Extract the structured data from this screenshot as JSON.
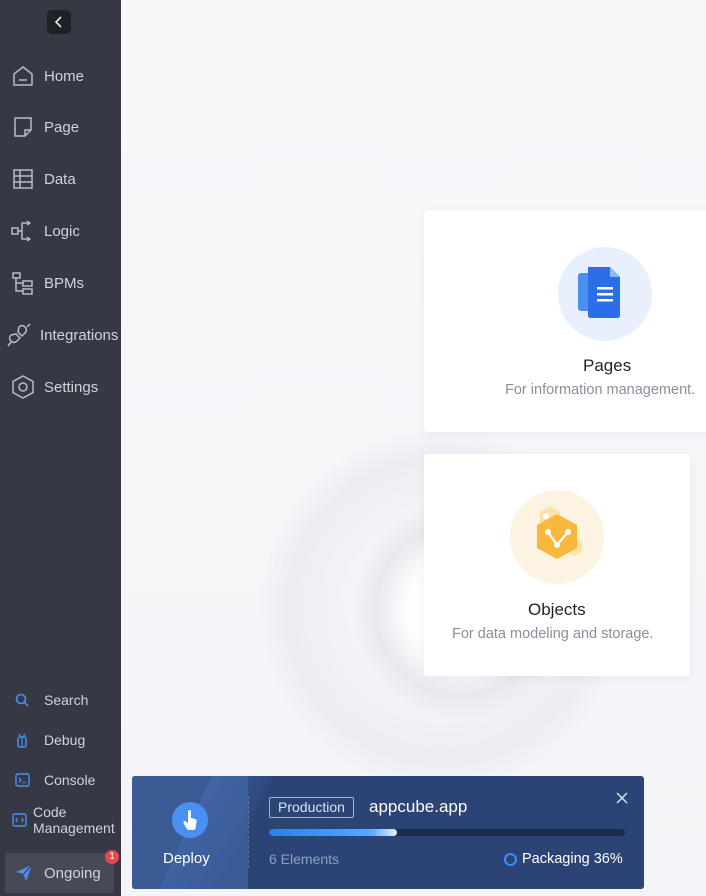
{
  "sidebar": {
    "nav": [
      {
        "label": "Home",
        "icon": "home-icon"
      },
      {
        "label": "Page",
        "icon": "page-icon"
      },
      {
        "label": "Data",
        "icon": "table-icon"
      },
      {
        "label": "Logic",
        "icon": "logic-flow-icon"
      },
      {
        "label": "BPMs",
        "icon": "bpm-tree-icon"
      },
      {
        "label": "Integrations",
        "icon": "plug-icon"
      },
      {
        "label": "Settings",
        "icon": "hexagon-settings-icon"
      }
    ],
    "tools": [
      {
        "label": "Search",
        "icon": "search-icon"
      },
      {
        "label": "Debug",
        "icon": "debug-icon"
      },
      {
        "label": "Console",
        "icon": "console-icon"
      },
      {
        "label": "Code Management",
        "icon": "code-icon"
      }
    ],
    "ongoing": {
      "label": "Ongoing",
      "badge": "1",
      "icon": "send-icon"
    }
  },
  "cards": [
    {
      "title": "Pages",
      "description": "For information management.",
      "icon": "document-icon"
    },
    {
      "title": "Objects",
      "description": "For data modeling and storage.",
      "icon": "hexagon-object-icon"
    }
  ],
  "deploy_panel": {
    "button_label": "Deploy",
    "environment": "Production",
    "app_name": "appcube.app",
    "elements": "6 Elements",
    "status": "Packaging 36%",
    "progress": 0.36
  },
  "colors": {
    "sidebar_bg": "#363943",
    "accent": "#2b7df0",
    "panel_bg": "#2b4475",
    "badge": "#e5484d"
  }
}
